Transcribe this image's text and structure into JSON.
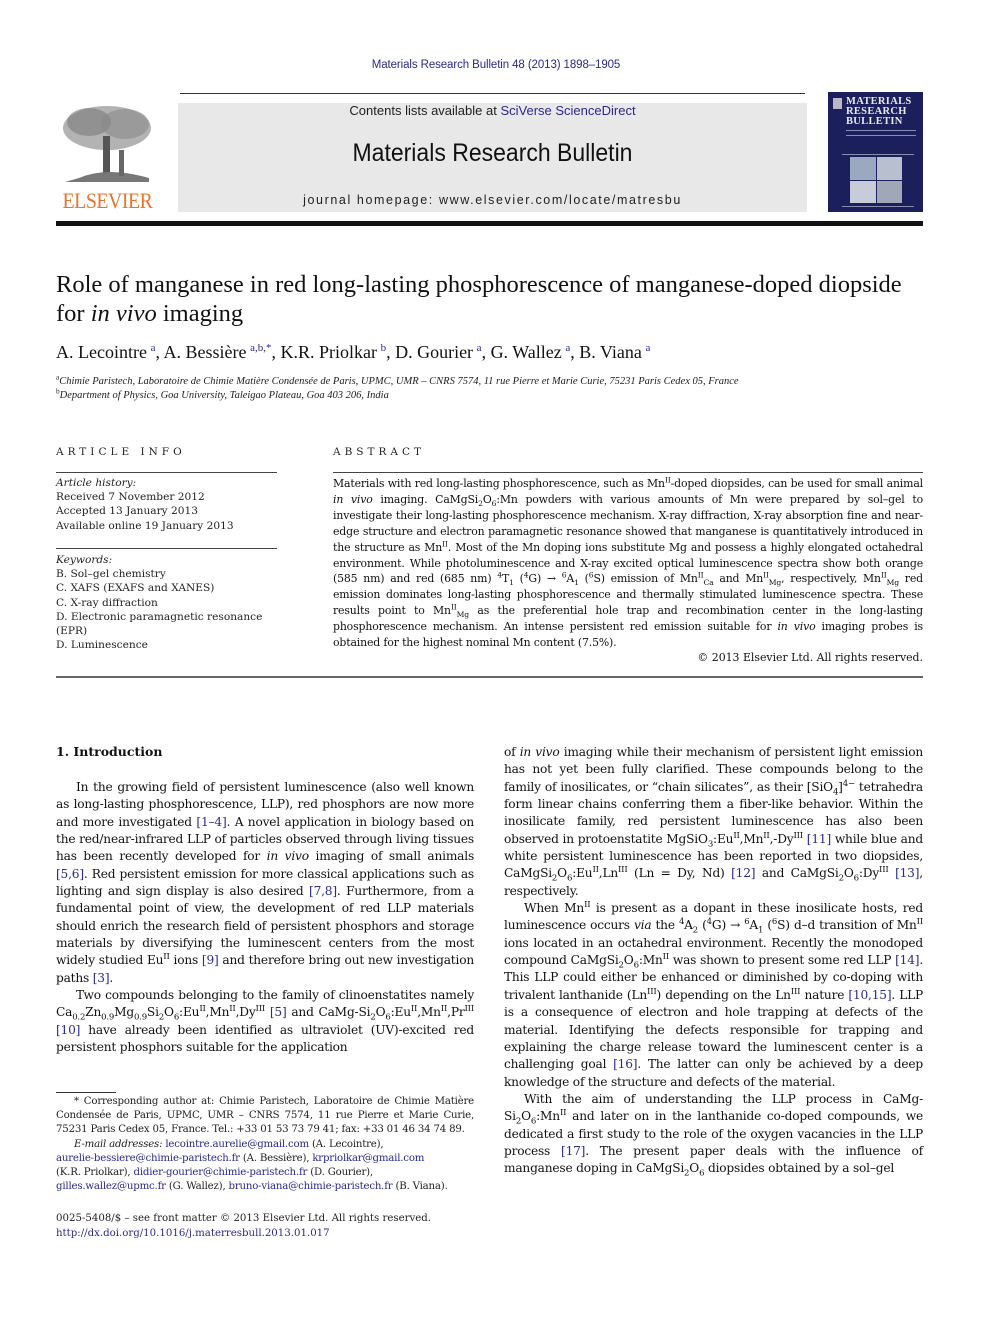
{
  "journal_ref": "Materials Research Bulletin 48 (2013) 1898–1905",
  "header": {
    "contents_prefix": "Contents lists available at ",
    "contents_link": "SciVerse ScienceDirect",
    "journal_title": "Materials Research Bulletin",
    "homepage_prefix": "journal homepage: ",
    "homepage_url": "www.elsevier.com/locate/matresbu",
    "publisher_logo_text": "ELSEVIER",
    "cover_title_lines": [
      "MATERIALS",
      "RESEARCH",
      "BULLETIN"
    ],
    "brand_color": "#e8742a",
    "link_color": "#2a2a8c",
    "cover_color": "#1b1f5c"
  },
  "article": {
    "title_part1": "Role of manganese in red long-lasting phosphorescence of manganese-doped diopside for ",
    "title_italic": "in vivo",
    "title_part2": " imaging",
    "authors": [
      {
        "name": "A. Lecointre",
        "aff": "a"
      },
      {
        "name": "A. Bessière",
        "aff": "a,b,*"
      },
      {
        "name": "K.R. Priolkar",
        "aff": "b"
      },
      {
        "name": "D. Gourier",
        "aff": "a"
      },
      {
        "name": "G. Wallez",
        "aff": "a"
      },
      {
        "name": "B. Viana",
        "aff": "a"
      }
    ],
    "affiliations": [
      {
        "mark": "a",
        "text": "Chimie Paristech, Laboratoire de Chimie Matière Condensée de Paris, UPMC, UMR – CNRS 7574, 11 rue Pierre et Marie Curie, 75231 Paris Cedex 05, France"
      },
      {
        "mark": "b",
        "text": "Department of Physics, Goa University, Taleigao Plateau, Goa 403 206, India"
      }
    ]
  },
  "article_info": {
    "heading": "ARTICLE INFO",
    "history_label": "Article history:",
    "history": [
      "Received 7 November 2012",
      "Accepted 13 January 2013",
      "Available online 19 January 2013"
    ],
    "keywords_label": "Keywords:",
    "keywords": [
      "B. Sol–gel chemistry",
      "C. XAFS (EXAFS and XANES)",
      "C. X-ray diffraction",
      "D. Electronic paramagnetic resonance (EPR)",
      "D. Luminescence"
    ]
  },
  "abstract": {
    "heading": "ABSTRACT",
    "copyright": "© 2013 Elsevier Ltd. All rights reserved."
  },
  "introduction": {
    "heading": "1.  Introduction"
  },
  "footnotes": {
    "corresponding": "* Corresponding author at: Chimie Paristech, Laboratoire de Chimie Matière Condensée de Paris, UPMC, UMR – CNRS 7574, 11 rue Pierre et Marie Curie, 75231 Paris Cedex 05, France. Tel.: +33 01 53 73 79 41; fax: +33 01 46 34 74 89.",
    "email_label": "E-mail addresses:",
    "emails": [
      {
        "email": "lecointre.aurelie@gmail.com",
        "who": " (A. Lecointre),"
      },
      {
        "email": "aurelie-bessiere@chimie-paristech.fr",
        "who": " (A. Bessière),"
      },
      {
        "email": "krpriolkar@gmail.com",
        "who": " (K.R. Priolkar),"
      },
      {
        "email": "didier-gourier@chimie-paristech.fr",
        "who": " (D. Gourier),"
      },
      {
        "email": "gilles.wallez@upmc.fr",
        "who": " (G. Wallez),"
      },
      {
        "email": "bruno-viana@chimie-paristech.fr",
        "who": " (B. Viana)."
      }
    ],
    "front_matter": "0025-5408/$ – see front matter © 2013 Elsevier Ltd. All rights reserved.",
    "doi": "http://dx.doi.org/10.1016/j.materresbull.2013.01.017"
  },
  "refs": {
    "r1_4": "[1–4]",
    "r5_6": "[5,6]",
    "r7_8": "[7,8]",
    "r9": "[9]",
    "r3": "[3]",
    "r5": "[5]",
    "r10": "[10]",
    "r11": "[11]",
    "r12": "[12]",
    "r13": "[13]",
    "r14": "[14]",
    "r10_15": "[10,15]",
    "r16": "[16]",
    "r17": "[17]"
  }
}
